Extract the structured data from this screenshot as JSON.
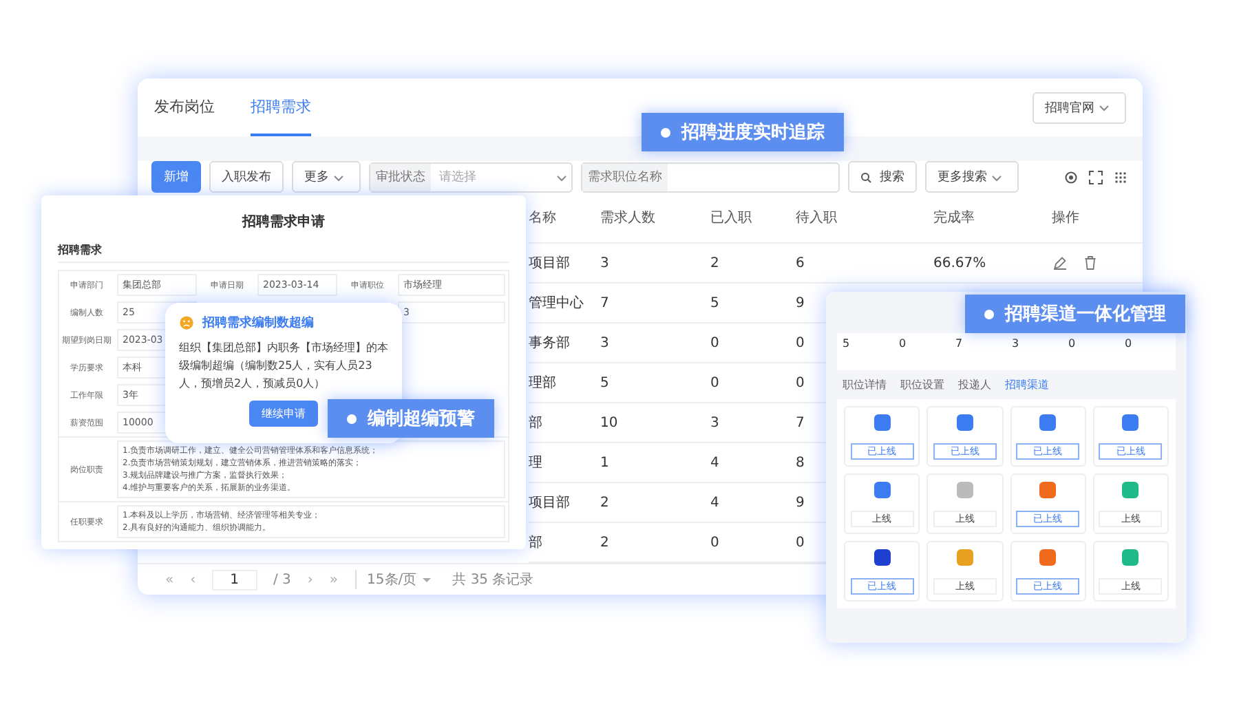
{
  "main": {
    "tabs": [
      {
        "label": "发布岗位",
        "selected": false
      },
      {
        "label": "招聘需求",
        "selected": true
      }
    ],
    "site_dropdown": "招聘官网",
    "toolbar": {
      "add": "新增",
      "publish": "入职发布",
      "more": "更多",
      "status_label": "审批状态",
      "status_placeholder": "请选择",
      "name_label": "需求职位名称",
      "search": "搜索",
      "more_search": "更多搜索"
    },
    "table": {
      "columns": [
        "名称",
        "需求人数",
        "已入职",
        "待入职",
        "完成率",
        "操作"
      ],
      "rows": [
        {
          "name": "项目部",
          "need": "3",
          "joined": "2",
          "pending": "6",
          "rate": "66.67%"
        },
        {
          "name": "管理中心",
          "need": "7",
          "joined": "5",
          "pending": "9"
        },
        {
          "name": "事务部",
          "need": "3",
          "joined": "0",
          "pending": "0"
        },
        {
          "name": "理部",
          "need": "5",
          "joined": "0",
          "pending": "0"
        },
        {
          "name": "部",
          "need": "10",
          "joined": "3",
          "pending": "7"
        },
        {
          "name": "理",
          "need": "1",
          "joined": "4",
          "pending": "8"
        },
        {
          "name": "项目部",
          "need": "2",
          "joined": "4",
          "pending": "9"
        },
        {
          "name": "部",
          "need": "2",
          "joined": "0",
          "pending": "0"
        }
      ]
    },
    "pagination": {
      "first": "«",
      "prev": "‹",
      "page": "1",
      "total_pages": "/ 3",
      "next": "›",
      "last": "»",
      "page_size": "15条/页",
      "total": "共 35 条记录"
    }
  },
  "dialog": {
    "title": "招聘需求申请",
    "section": "招聘需求",
    "form_rows": [
      [
        {
          "label": "申请部门",
          "value": "集团总部"
        },
        {
          "label": "申请日期",
          "value": "2023-03-14"
        },
        {
          "label": "申请职位",
          "value": "市场经理"
        }
      ],
      [
        {
          "label": "编制人数",
          "value": "25"
        },
        null,
        {
          "value": "3"
        }
      ],
      [
        {
          "label": "期望到岗日期",
          "value": "2023-03"
        },
        null,
        null
      ],
      [
        {
          "label": "学历要求",
          "value": "本科"
        },
        null,
        null
      ],
      [
        {
          "label": "工作年限",
          "value": "3年"
        },
        null,
        null
      ],
      [
        {
          "label": "薪资范围",
          "value": "10000"
        },
        null,
        null
      ]
    ],
    "duty_label": "岗位职责",
    "duty_lines": [
      "1.负责市场调研工作，建立、健全公司营销管理体系和客户信息系统；",
      "2.负责市场营销策划规划，建立营销体系，推进营销策略的落实；",
      "3.规划品牌建设与推广方案，监督执行效果；",
      "4.维护与重要客户的关系，拓展新的业务渠道。"
    ],
    "req_label": "任职要求",
    "req_lines": [
      "1.本科及以上学历，市场营销、经济管理等相关专业；",
      "2.具有良好的沟通能力、组织协调能力。"
    ],
    "alert": {
      "title": "招聘需求编制数超编",
      "body": "组织【集团总部】内职务【市场经理】的本级编制超编（编制数25人，实有人员23人，预增员2人，预减员0人）",
      "button": "继续申请"
    }
  },
  "channels": {
    "stats": [
      "5",
      "0",
      "7",
      "3",
      "0",
      "0"
    ],
    "tabs": [
      {
        "label": "职位详情",
        "selected": false
      },
      {
        "label": "职位设置",
        "selected": false
      },
      {
        "label": "投递人",
        "selected": false
      },
      {
        "label": "招聘渠道",
        "selected": true
      }
    ],
    "cards": [
      {
        "color": "#3b7df0",
        "online": true,
        "button": "已上线"
      },
      {
        "color": "#3b7df0",
        "online": true,
        "button": "已上线"
      },
      {
        "color": "#3b7df0",
        "online": true,
        "button": "已上线"
      },
      {
        "color": "#3b7df0",
        "online": true,
        "button": "已上线"
      },
      {
        "color": "#3b7df0",
        "online": false,
        "button": "上线"
      },
      {
        "color": "#bbbbbb",
        "online": false,
        "button": "上线"
      },
      {
        "color": "#f06a1e",
        "online": true,
        "button": "已上线"
      },
      {
        "color": "#1fb98a",
        "online": false,
        "button": "上线"
      },
      {
        "color": "#1e3fd0",
        "online": true,
        "button": "已上线"
      },
      {
        "color": "#e8a020",
        "online": false,
        "button": "上线"
      },
      {
        "color": "#f06a1e",
        "online": true,
        "button": "已上线"
      },
      {
        "color": "#1fb98a",
        "online": false,
        "button": "上线"
      }
    ]
  },
  "callouts": [
    "招聘进度实时追踪",
    "编制超编预警",
    "招聘渠道一体化管理"
  ]
}
